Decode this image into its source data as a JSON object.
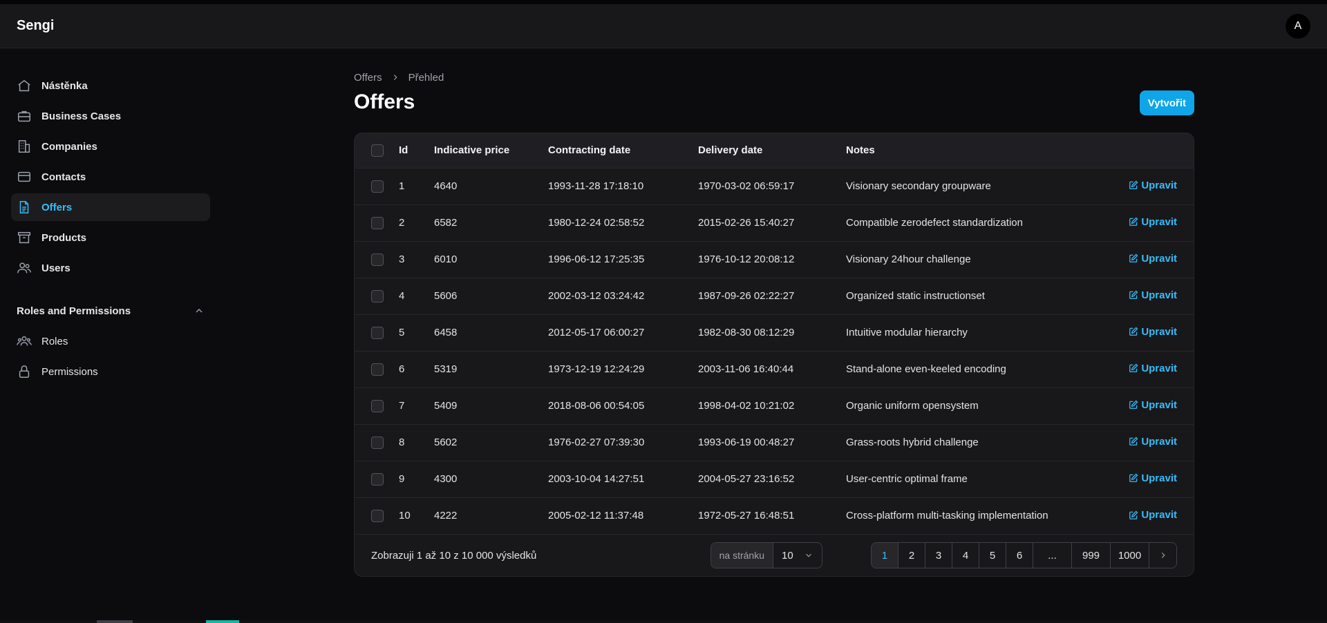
{
  "app": {
    "brand": "Sengi",
    "avatar_initial": "A"
  },
  "sidebar": {
    "items": [
      {
        "label": "Nástěnka",
        "icon": "home-icon"
      },
      {
        "label": "Business Cases",
        "icon": "briefcase-icon"
      },
      {
        "label": "Companies",
        "icon": "building-icon"
      },
      {
        "label": "Contacts",
        "icon": "card-icon"
      },
      {
        "label": "Offers",
        "icon": "document-icon",
        "active": true
      },
      {
        "label": "Products",
        "icon": "archive-icon"
      },
      {
        "label": "Users",
        "icon": "users-icon"
      }
    ],
    "group": {
      "label": "Roles and Permissions",
      "items": [
        {
          "label": "Roles",
          "icon": "user-group-icon"
        },
        {
          "label": "Permissions",
          "icon": "lock-icon"
        }
      ]
    }
  },
  "breadcrumb": {
    "root": "Offers",
    "current": "Přehled"
  },
  "page": {
    "title": "Offers",
    "create_label": "Vytvořit"
  },
  "table": {
    "headers": {
      "id": "Id",
      "price": "Indicative price",
      "contracting": "Contracting date",
      "delivery": "Delivery date",
      "notes": "Notes"
    },
    "edit_label": "Upravit",
    "rows": [
      {
        "id": "1",
        "price": "4640",
        "contracting": "1993-11-28 17:18:10",
        "delivery": "1970-03-02 06:59:17",
        "notes": "Visionary secondary groupware"
      },
      {
        "id": "2",
        "price": "6582",
        "contracting": "1980-12-24 02:58:52",
        "delivery": "2015-02-26 15:40:27",
        "notes": "Compatible zerodefect standardization"
      },
      {
        "id": "3",
        "price": "6010",
        "contracting": "1996-06-12 17:25:35",
        "delivery": "1976-10-12 20:08:12",
        "notes": "Visionary 24hour challenge"
      },
      {
        "id": "4",
        "price": "5606",
        "contracting": "2002-03-12 03:24:42",
        "delivery": "1987-09-26 02:22:27",
        "notes": "Organized static instructionset"
      },
      {
        "id": "5",
        "price": "6458",
        "contracting": "2012-05-17 06:00:27",
        "delivery": "1982-08-30 08:12:29",
        "notes": "Intuitive modular hierarchy"
      },
      {
        "id": "6",
        "price": "5319",
        "contracting": "1973-12-19 12:24:29",
        "delivery": "2003-11-06 16:40:44",
        "notes": "Stand-alone even-keeled encoding"
      },
      {
        "id": "7",
        "price": "5409",
        "contracting": "2018-08-06 00:54:05",
        "delivery": "1998-04-02 10:21:02",
        "notes": "Organic uniform opensystem"
      },
      {
        "id": "8",
        "price": "5602",
        "contracting": "1976-02-27 07:39:30",
        "delivery": "1993-06-19 00:48:27",
        "notes": "Grass-roots hybrid challenge"
      },
      {
        "id": "9",
        "price": "4300",
        "contracting": "2003-10-04 14:27:51",
        "delivery": "2004-05-27 23:16:52",
        "notes": "User-centric optimal frame"
      },
      {
        "id": "10",
        "price": "4222",
        "contracting": "2005-02-12 11:37:48",
        "delivery": "1972-05-27 16:48:51",
        "notes": "Cross-platform multi-tasking implementation"
      }
    ]
  },
  "footer": {
    "summary": "Zobrazuji 1 až 10 z 10 000 výsledků",
    "perpage_label": "na stránku",
    "perpage_value": "10",
    "pages": [
      "1",
      "2",
      "3",
      "4",
      "5",
      "6",
      "...",
      "999",
      "1000"
    ],
    "active_page": "1"
  },
  "colors": {
    "accent": "#38bdf8",
    "button": "#0ea5e9",
    "background": "#0c0c0e",
    "surface": "#18181b"
  }
}
